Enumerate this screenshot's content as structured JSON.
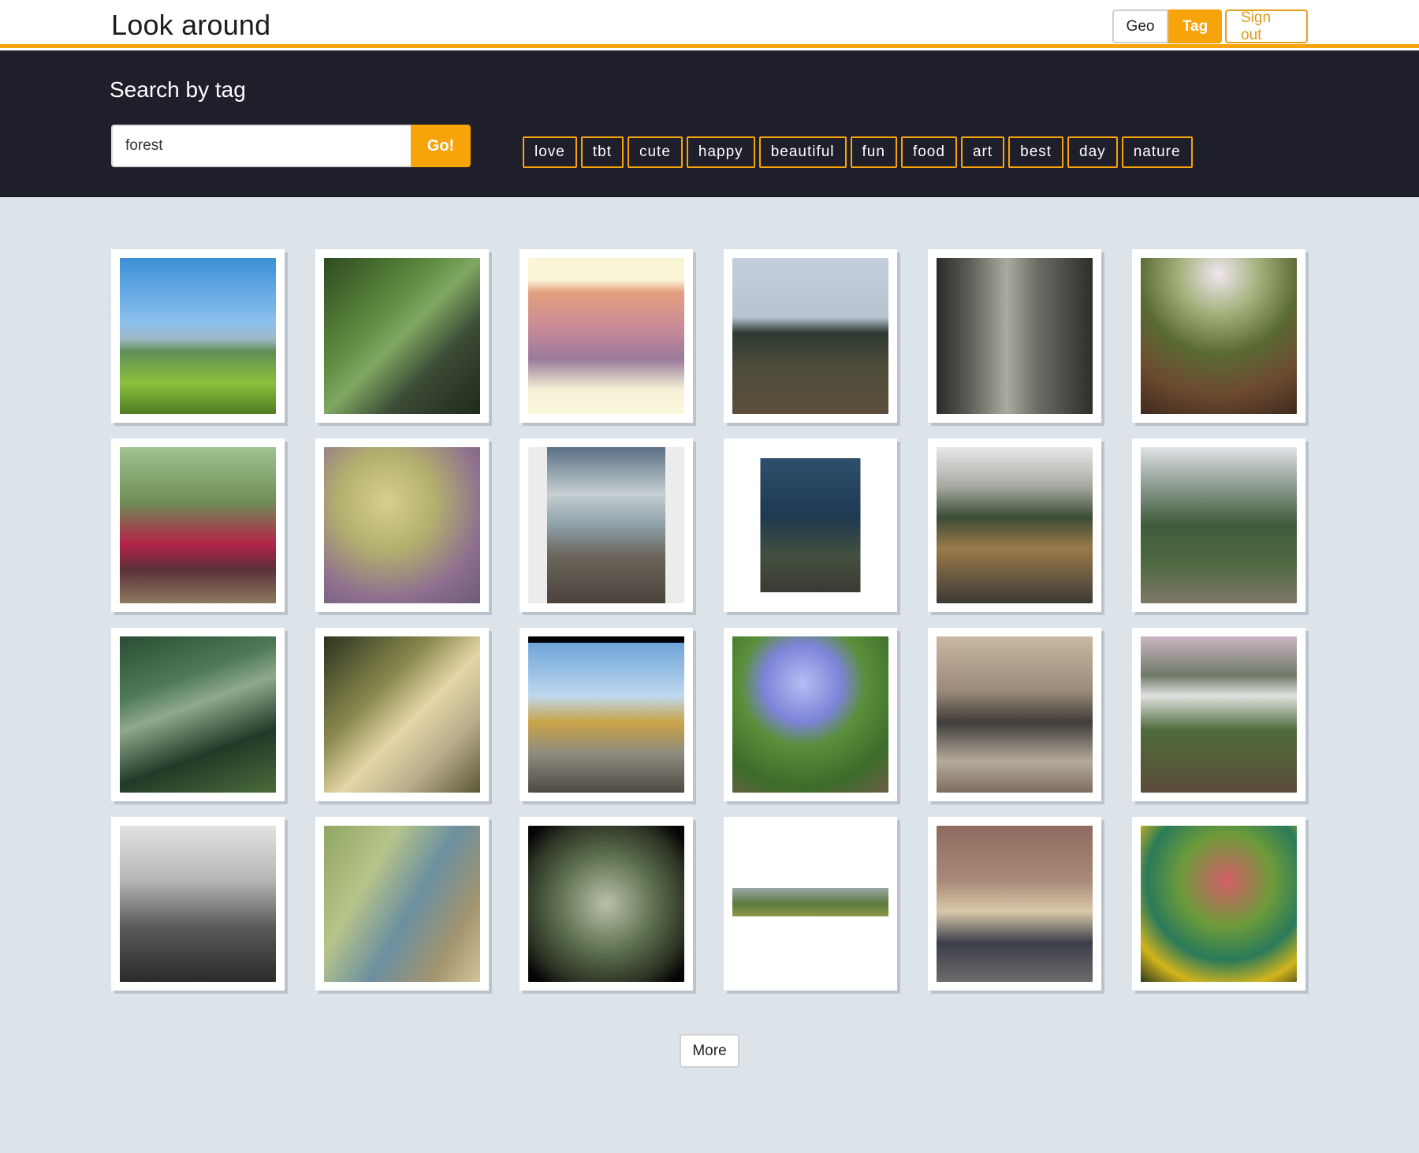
{
  "header": {
    "title": "Look around",
    "nav": {
      "geo_label": "Geo",
      "tag_label": "Tag",
      "signout_label": "Sign out"
    }
  },
  "search": {
    "heading": "Search by tag",
    "value": "forest",
    "go_label": "Go!",
    "tags": [
      "love",
      "tbt",
      "cute",
      "happy",
      "beautiful",
      "fun",
      "food",
      "art",
      "best",
      "day",
      "nature"
    ]
  },
  "more_label": "More"
}
